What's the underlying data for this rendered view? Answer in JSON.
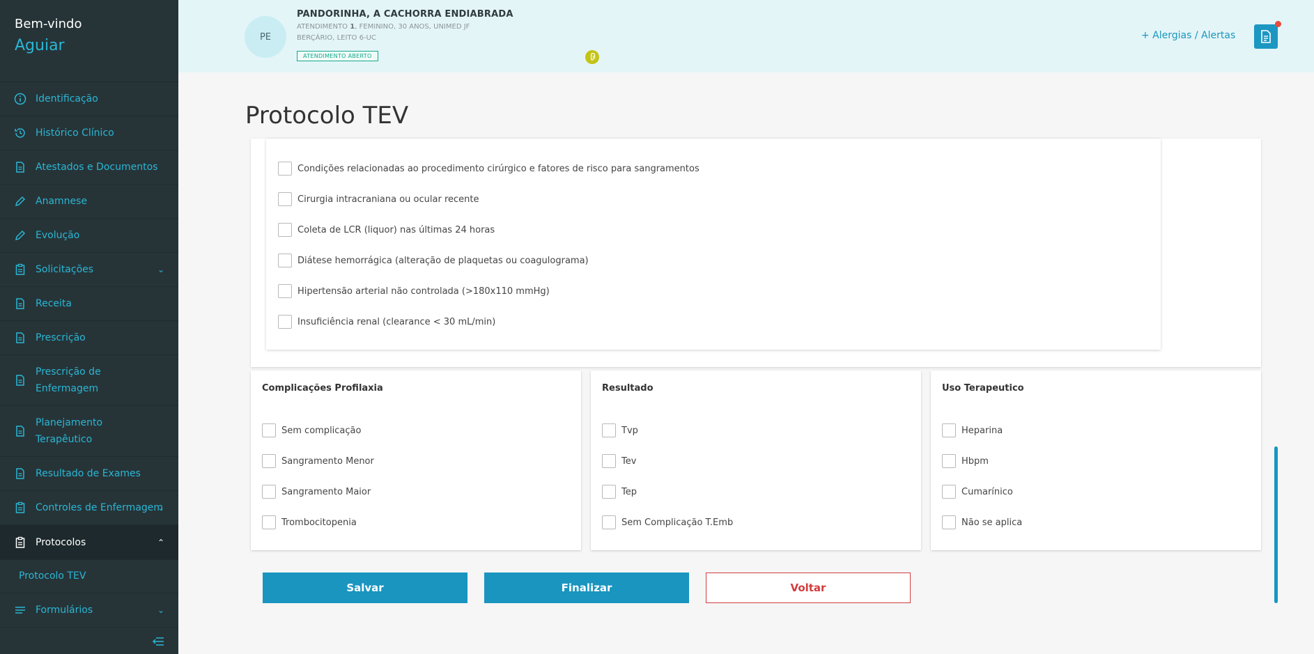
{
  "sidebar": {
    "hello": "Bem-vindo",
    "user": "Aguiar",
    "items": [
      {
        "label": "Identificação"
      },
      {
        "label": "Histórico Clínico"
      },
      {
        "label": "Atestados e Documentos"
      },
      {
        "label": "Anamnese"
      },
      {
        "label": "Evolução"
      },
      {
        "label": "Solicitações"
      },
      {
        "label": "Receita"
      },
      {
        "label": "Prescrição"
      },
      {
        "label": "Prescrição de Enfermagem"
      },
      {
        "label": "Planejamento Terapêutico"
      },
      {
        "label": "Resultado de Exames"
      },
      {
        "label": "Controles de Enfermagem"
      },
      {
        "label": "Protocolos"
      },
      {
        "label": "Formulários"
      }
    ],
    "sub_item": "Protocolo TEV"
  },
  "header": {
    "avatar_initials": "PE",
    "patient_name": "PANDORINHA, A CACHORRA ENDIABRADA",
    "attendance_prefix": "ATENDIMENTO ",
    "attendance_number": "1",
    "attendance_suffix": ", FEMININO, 30 ANOS, UNIMED JF",
    "location": "BERÇÁRIO, LEITO 6-UC",
    "status_badge": "ATENDIMENTO ABERTO",
    "alerts_link": "+  Alergias / Alertas"
  },
  "page": {
    "title": "Protocolo TEV"
  },
  "risk_checklist": [
    "Condições relacionadas ao procedimento cirúrgico e fatores de risco para sangramentos",
    "Cirurgia intracraniana ou ocular recente",
    "Coleta de LCR (liquor) nas últimas 24 horas",
    "Diátese hemorrágica (alteração de plaquetas ou coagulograma)",
    "Hipertensão arterial não controlada (>180x110 mmHg)",
    "Insuficiência renal (clearance < 30 mL/min)"
  ],
  "panels": {
    "complicacoes": {
      "title": "Complicações Profilaxia",
      "options": [
        "Sem complicação",
        "Sangramento Menor",
        "Sangramento Maior",
        "Trombocitopenia"
      ]
    },
    "resultado": {
      "title": "Resultado",
      "options": [
        "Tvp",
        "Tev",
        "Tep",
        "Sem Complicação T.Emb"
      ]
    },
    "uso": {
      "title": "Uso Terapeutico",
      "options": [
        "Heparina",
        "Hbpm",
        "Cumarínico",
        "Não se aplica"
      ]
    }
  },
  "buttons": {
    "save": "Salvar",
    "finish": "Finalizar",
    "back": "Voltar"
  },
  "colors": {
    "sidebar_bg": "#263438",
    "accent": "#2bb6d4",
    "primary_button": "#1995c0",
    "danger": "#d23c3c",
    "header_bg": "#e4f5f8"
  }
}
